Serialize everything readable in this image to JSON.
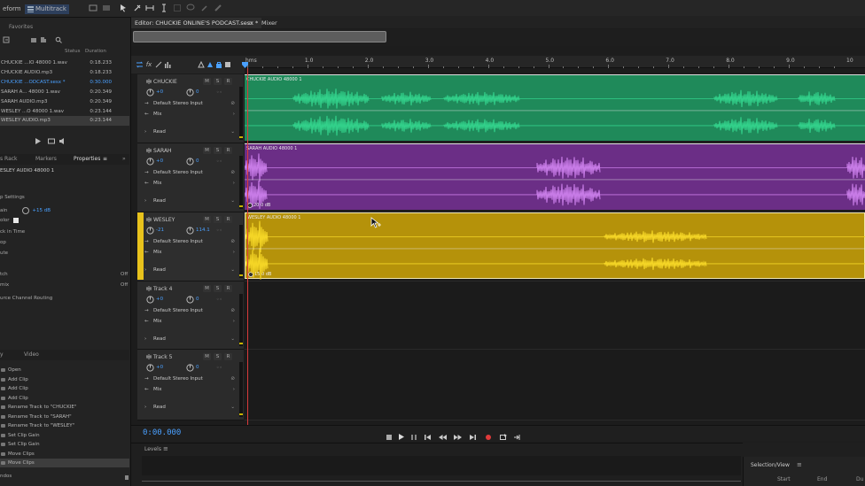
{
  "toolbar": {
    "waveform_tab": "eform",
    "multitrack_tab": "Multitrack"
  },
  "files_panel": {
    "title": "Favorites",
    "col_status": "Status",
    "col_duration": "Duration",
    "files": [
      {
        "name": "CHUCKIE ...IO 48000 1.wav",
        "duration": "0:18.233"
      },
      {
        "name": "CHUCKIE AUDIO.mp3",
        "duration": "0:18.233"
      },
      {
        "name": "CHUCKIE ...ODCAST.sesx *",
        "duration": "0:30.000",
        "active": true
      },
      {
        "name": "SARAH A... 48000 1.wav",
        "duration": "0:20.349"
      },
      {
        "name": "SARAH AUDIO.mp3",
        "duration": "0:20.349"
      },
      {
        "name": "WESLEY ...O 48000 1.wav",
        "duration": "0:23.144"
      },
      {
        "name": "WESLEY AUDIO.mp3",
        "duration": "0:23.144",
        "selected": true
      }
    ]
  },
  "properties_tabs": {
    "tab1": "s Rack",
    "tab2": "Markers",
    "tab3": "Properties"
  },
  "properties": {
    "clip_name": "ESLEY AUDIO 48000 1",
    "section": "p Settings",
    "gain_label": "ain",
    "gain_value": "+15 dB",
    "color_label": "olor",
    "lock_label": "ck in Time",
    "loop_label": "op",
    "mute_label": "ute",
    "switch_label": "tch",
    "switch_value": "Off",
    "mix_label": "mix",
    "mix_value": "Off",
    "routing_label": "urce Channel Routing"
  },
  "history": {
    "tab1": "y",
    "tab2": "Video",
    "items": [
      "Open",
      "Add Clip",
      "Add Clip",
      "Add Clip",
      "Rename Track to \"CHUCKIE\"",
      "Rename Track to \"SARAH\"",
      "Rename Track to \"WESLEY\"",
      "Set Clip Gain",
      "Set Clip Gain",
      "Move Clips",
      "Move Clips"
    ],
    "footer": "ndos"
  },
  "editor": {
    "tab_title": "Editor: CHUCKIE ONLINE'S PODCAST.sesx *",
    "mixer_tab": "Mixer",
    "ruler_unit": "hms",
    "ruler_ticks": [
      "1.0",
      "2.0",
      "3.0",
      "4.0",
      "5.0",
      "6.0",
      "7.0",
      "8.0",
      "9.0",
      "10"
    ],
    "timecode": "0:00.000"
  },
  "tracks": [
    {
      "name": "CHUCKIE",
      "volume": "+0",
      "pan": "0",
      "input": "Default Stereo Input",
      "mix": "Mix",
      "mode": "Read",
      "clip": "CHUCKIE AUDIO 48000 1",
      "color": "#1f8a5a",
      "wave": "#32d08a"
    },
    {
      "name": "SARAH",
      "volume": "+0",
      "pan": "0",
      "input": "Default Stereo Input",
      "mix": "Mix",
      "mode": "Read",
      "clip": "SARAH AUDIO 48000 1",
      "gain": "20.0 dB",
      "color": "#6b2e86",
      "wave": "#c77be6"
    },
    {
      "name": "WESLEY",
      "volume": "-21",
      "pan": "114.1",
      "input": "Default Stereo Input",
      "mix": "Mix",
      "mode": "Read",
      "clip": "WESLEY AUDIO 48000 1",
      "gain": "15.0 dB",
      "color": "#b5920a",
      "wave": "#f4d526"
    },
    {
      "name": "Track 4",
      "volume": "+0",
      "pan": "0",
      "input": "Default Stereo Input",
      "mix": "Mix",
      "mode": "Read"
    },
    {
      "name": "Track 5",
      "volume": "+0",
      "pan": "0",
      "input": "Default Stereo Input",
      "mix": "Mix",
      "mode": "Read"
    }
  ],
  "levels": {
    "title": "Levels"
  },
  "selection_view": {
    "title": "Selection/View",
    "col_start": "Start",
    "col_end": "End",
    "col_duration": "Du"
  },
  "colors": {
    "accent": "#2f7de1",
    "selected_track": "#e8c21c",
    "playhead": "#d93a3a"
  }
}
